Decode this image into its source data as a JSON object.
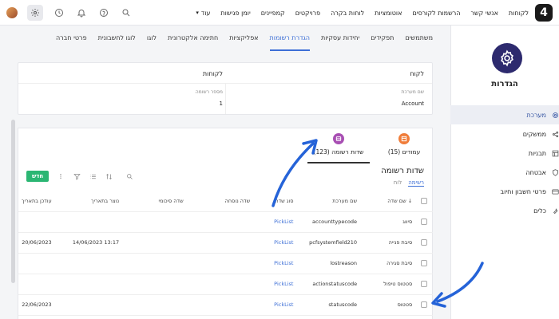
{
  "topbar": {
    "logo": "4",
    "nav": [
      "לקוחות",
      "אנשי קשר",
      "הרשמות לקורסים",
      "אוטומציות",
      "לוחות בקרה",
      "פרויקטים",
      "קמפיינים",
      "יומן פגישות"
    ],
    "more_label": "עוד",
    "icons": [
      "search-icon",
      "help-icon",
      "bell-icon",
      "clock-icon",
      "gear-icon",
      "avatar"
    ]
  },
  "sidebar": {
    "title": "הגדרות",
    "items": [
      {
        "label": "מערכת",
        "icon": "gear-icon",
        "active": true
      },
      {
        "label": "ממשקים",
        "icon": "share-icon",
        "active": false
      },
      {
        "label": "תבניות",
        "icon": "template-icon",
        "active": false
      },
      {
        "label": "אבטחה",
        "icon": "shield-icon",
        "active": false
      },
      {
        "label": "פרטי חשבון וחיוב",
        "icon": "card-icon",
        "active": false
      },
      {
        "label": "כלים",
        "icon": "tools-icon",
        "active": false
      }
    ]
  },
  "tabs": [
    "משתמשים",
    "תפקידים",
    "יחידות עסקיות",
    "הגדרת רשומות",
    "אפליקציות",
    "חתימה אלקטרונית",
    "לוגו",
    "לוגו לחשבונית",
    "פרטי חברה"
  ],
  "active_tab": "הגדרת רשומות",
  "account": {
    "header_right": "לקוח",
    "header_left": "לקוחות",
    "system_name_label": "שם מערכת",
    "system_name_value": "Account",
    "record_number_label": "מספר רשומה",
    "record_number_value": "1"
  },
  "subtabs": [
    {
      "label": "עמודים (15)",
      "color": "#f07d3a"
    },
    {
      "label": "שדות רשומה (123)",
      "color": "#a84fb3"
    }
  ],
  "section": {
    "title": "שדות רשומה",
    "view_list": "רשימה",
    "view_board": "לוח",
    "new_button": "חדש"
  },
  "table": {
    "headers": [
      "שם שדה",
      "שם מערכת",
      "סוג שדה",
      "שדה נוסחה",
      "שדה סיכומי",
      "נוצר בתאריך",
      "עודכן בתאריך"
    ],
    "rows": [
      [
        "סיווג",
        "accounttypecode",
        "PickList",
        "",
        "",
        "",
        ""
      ],
      [
        "סיבת פנייה",
        "pcfsystemfield210",
        "PickList",
        "",
        "",
        "13:17 14/06/2023",
        "20/06/2023"
      ],
      [
        "סיבת סגירה",
        "lostreason",
        "PickList",
        "",
        "",
        "",
        ""
      ],
      [
        "סטטוס טיפול",
        "actionstatuscode",
        "PickList",
        "",
        "",
        "",
        ""
      ],
      [
        "סטטוס",
        "statuscode",
        "PickList",
        "",
        "",
        "",
        "22/06/2023"
      ]
    ]
  },
  "colors": {
    "accent": "#3d6fd6",
    "new_button": "#2bb673",
    "arrow": "#2563d8",
    "sidebar_gear_bg": "#2d2a6e"
  }
}
